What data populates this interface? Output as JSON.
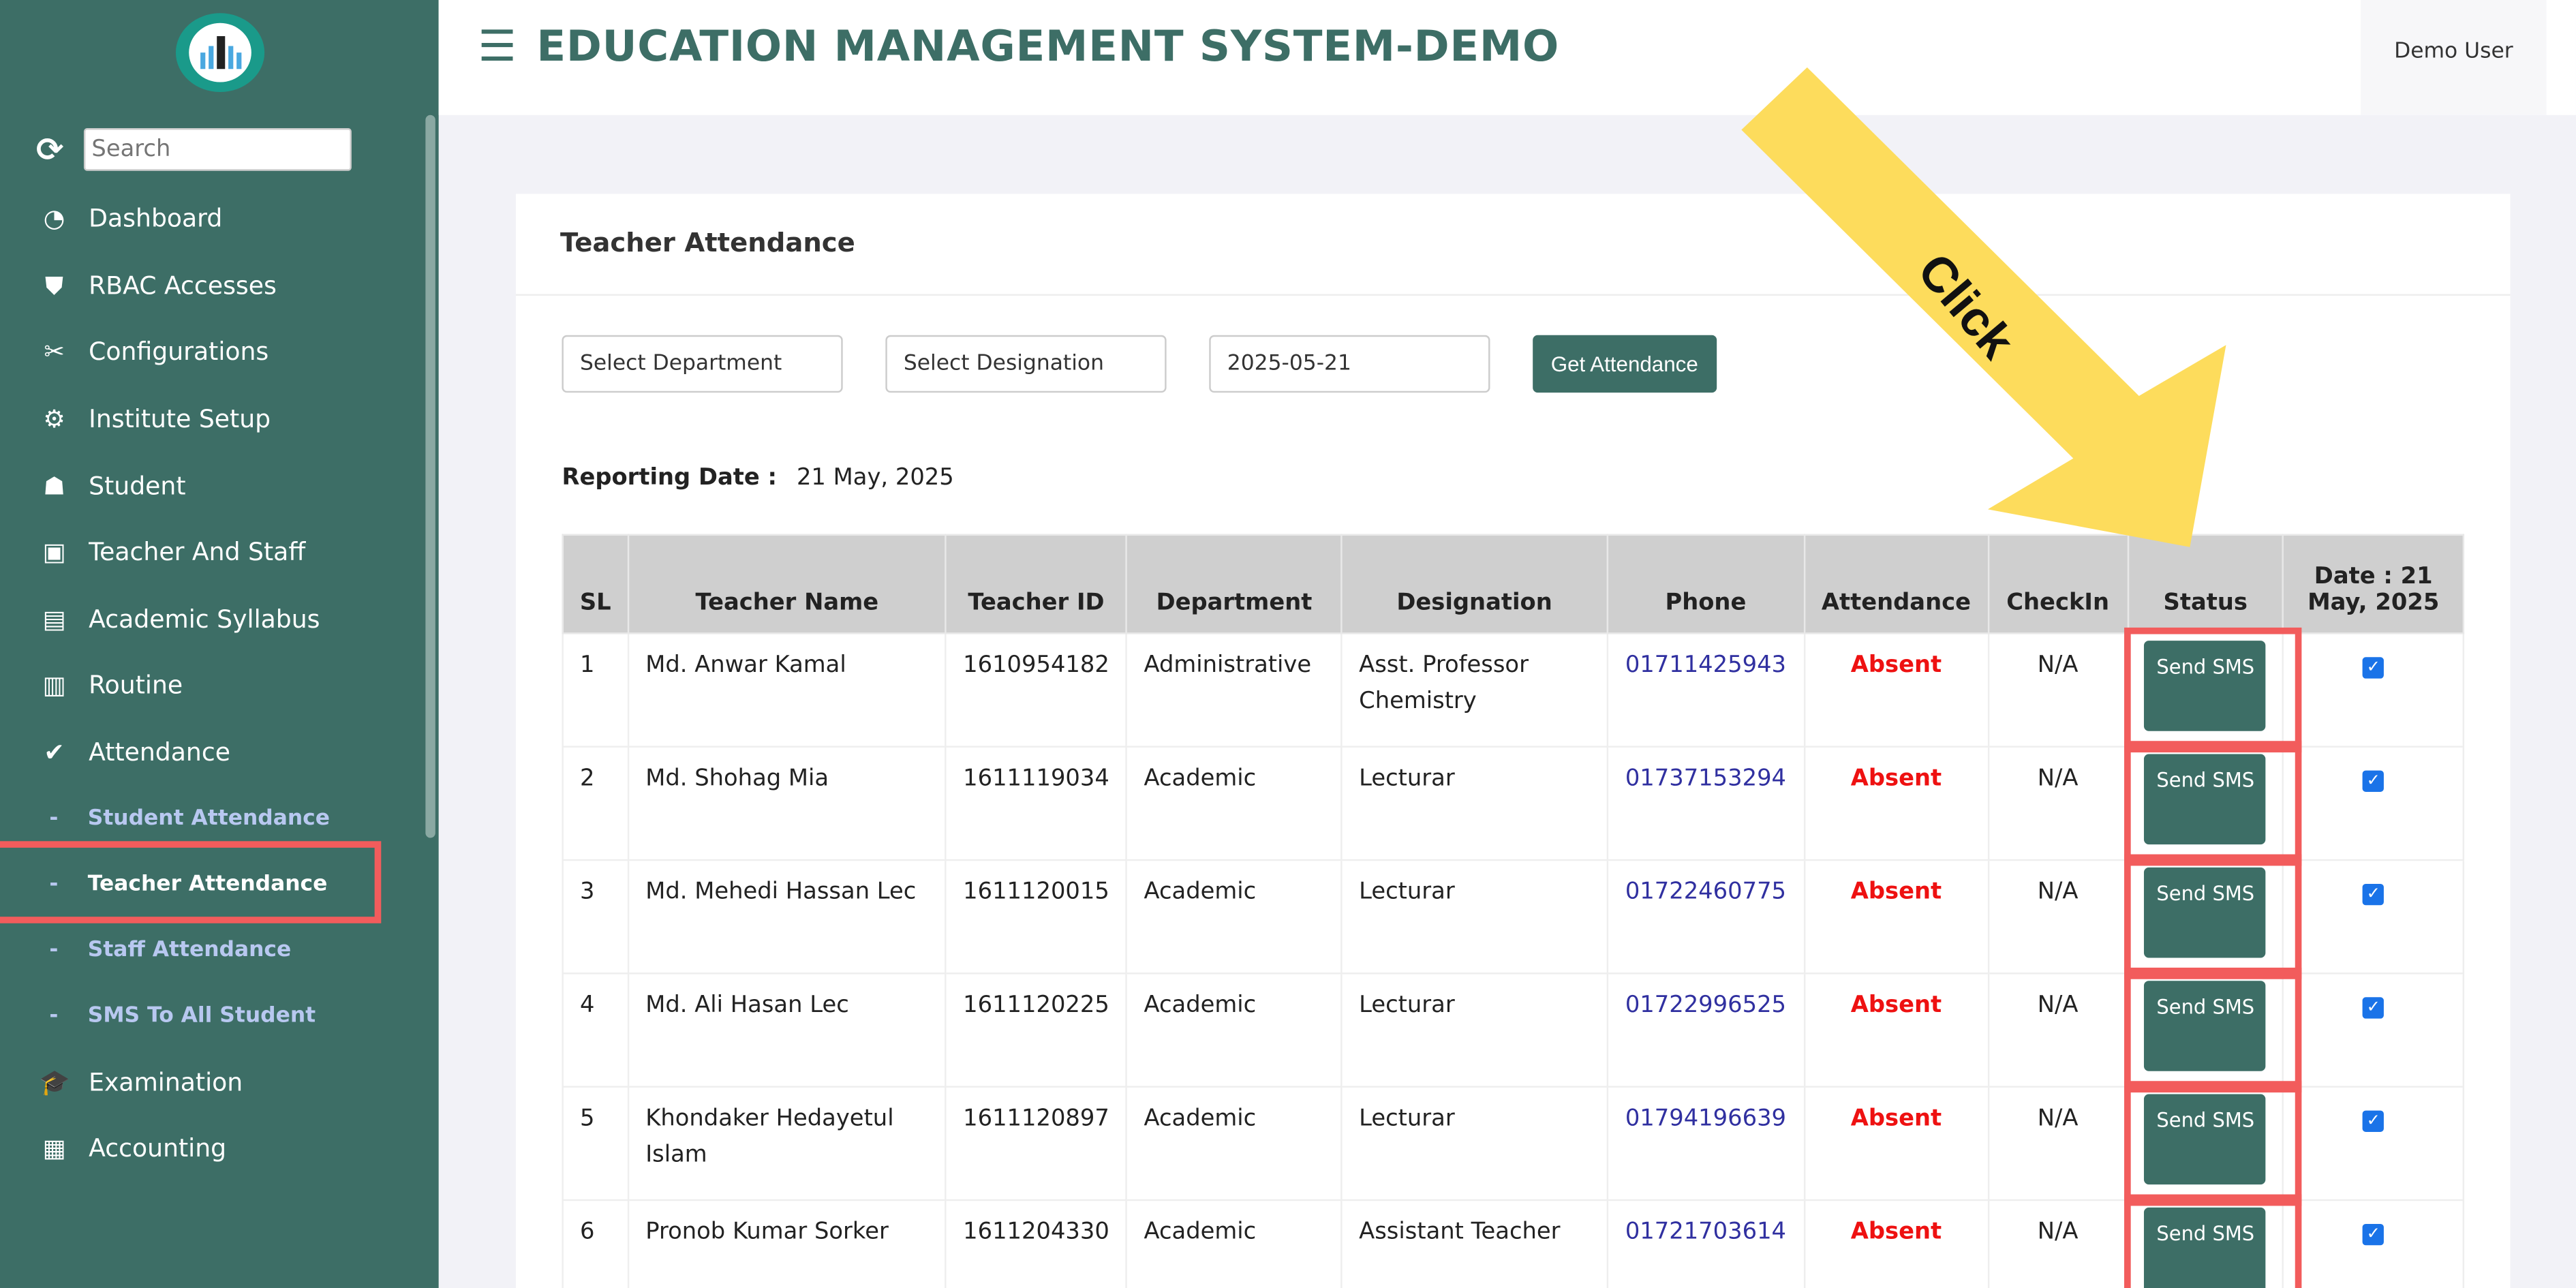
{
  "header": {
    "title": "EDUCATION MANAGEMENT SYSTEM-DEMO",
    "user": "Demo User"
  },
  "sidebar": {
    "search_placeholder": "Search",
    "items": [
      {
        "label": "Dashboard",
        "icon": "dashboard-icon"
      },
      {
        "label": "RBAC Accesses",
        "icon": "shield-icon"
      },
      {
        "label": "Configurations",
        "icon": "tools-icon"
      },
      {
        "label": "Institute Setup",
        "icon": "gear-icon"
      },
      {
        "label": "Student",
        "icon": "student-icon"
      },
      {
        "label": "Teacher And Staff",
        "icon": "teacher-icon"
      },
      {
        "label": "Academic Syllabus",
        "icon": "document-icon"
      },
      {
        "label": "Routine",
        "icon": "clipboard-icon"
      },
      {
        "label": "Attendance",
        "icon": "check-circle-icon"
      }
    ],
    "sub_items": [
      "Student Attendance",
      "Teacher Attendance",
      "Staff Attendance",
      "SMS To All Student"
    ],
    "items_after": [
      {
        "label": "Examination",
        "icon": "graduation-cap-icon"
      },
      {
        "label": "Accounting",
        "icon": "money-icon"
      }
    ]
  },
  "card": {
    "title": "Teacher Attendance",
    "filters": {
      "department": "Select Department",
      "designation": "Select Designation",
      "date": "2025-05-21",
      "button": "Get Attendance"
    },
    "reporting_label": "Reporting Date :",
    "reporting_date": "21 May, 2025"
  },
  "table": {
    "headers": [
      "SL",
      "Teacher Name",
      "Teacher ID",
      "Department",
      "Designation",
      "Phone",
      "Attendance",
      "CheckIn",
      "Status",
      "Date : 21 May, 2025"
    ],
    "rows": [
      [
        "1",
        "Md. Anwar Kamal",
        "1610954182",
        "Administrative",
        "Asst. Professor Chemistry",
        "01711425943",
        "Absent",
        "N/A",
        "Send SMS"
      ],
      [
        "2",
        "Md. Shohag Mia",
        "1611119034",
        "Academic",
        "Lecturar",
        "01737153294",
        "Absent",
        "N/A",
        "Send SMS"
      ],
      [
        "3",
        "Md. Mehedi Hassan Lec",
        "1611120015",
        "Academic",
        "Lecturar",
        "01722460775",
        "Absent",
        "N/A",
        "Send SMS"
      ],
      [
        "4",
        "Md. Ali Hasan Lec",
        "1611120225",
        "Academic",
        "Lecturar",
        "01722996525",
        "Absent",
        "N/A",
        "Send SMS"
      ],
      [
        "5",
        "Khondaker Hedayetul Islam",
        "1611120897",
        "Academic",
        "Lecturar",
        "01794196639",
        "Absent",
        "N/A",
        "Send SMS"
      ],
      [
        "6",
        "Pronob Kumar Sorker",
        "1611204330",
        "Academic",
        "Assistant Teacher",
        "01721703614",
        "Absent",
        "N/A",
        "Send SMS"
      ]
    ]
  },
  "annotation": {
    "text": "Click",
    "arrow_color": "#fddc5c",
    "highlight_color": "#f25c5c"
  },
  "colors": {
    "brand": "#3d6e66",
    "absent": "#ee1111",
    "phone": "#3030a0"
  }
}
